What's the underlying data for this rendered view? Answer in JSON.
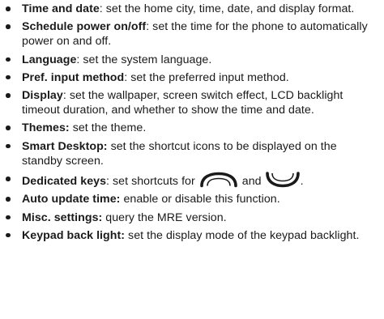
{
  "settings_list": [
    {
      "term": "Time and date",
      "sep": ": ",
      "desc": "set the home city, time, date, and display format."
    },
    {
      "term": "Schedule power on/off",
      "sep": ": ",
      "desc": "set the time for the phone to automatically power on and off."
    },
    {
      "term": "Language",
      "sep": ": ",
      "desc": "set the system language."
    },
    {
      "term": "Pref. input method",
      "sep": ": ",
      "desc": "set the preferred input method."
    },
    {
      "term": "Display",
      "sep": ": ",
      "desc": "set the wallpaper, screen switch effect, LCD backlight timeout duration, and whether to show the time and date."
    },
    {
      "term": "Themes:",
      "sep": " ",
      "desc": "set the theme."
    },
    {
      "term": "Smart Desktop:",
      "sep": " ",
      "desc": "set the shortcut icons to be displayed on the standby screen."
    },
    {
      "term": "Dedicated keys",
      "sep": ": ",
      "desc_before": "set shortcuts for",
      "desc_mid": "and",
      "desc_after": ".",
      "icons": [
        "up-key-icon",
        "down-key-icon"
      ]
    },
    {
      "term": "Auto update time:",
      "sep": " ",
      "desc": "enable or disable this function."
    },
    {
      "term": "Misc. settings:",
      "sep": " ",
      "desc": "query the MRE version."
    },
    {
      "term": "Keypad back light:",
      "sep": " ",
      "desc": "set the display mode of the keypad backlight."
    }
  ]
}
